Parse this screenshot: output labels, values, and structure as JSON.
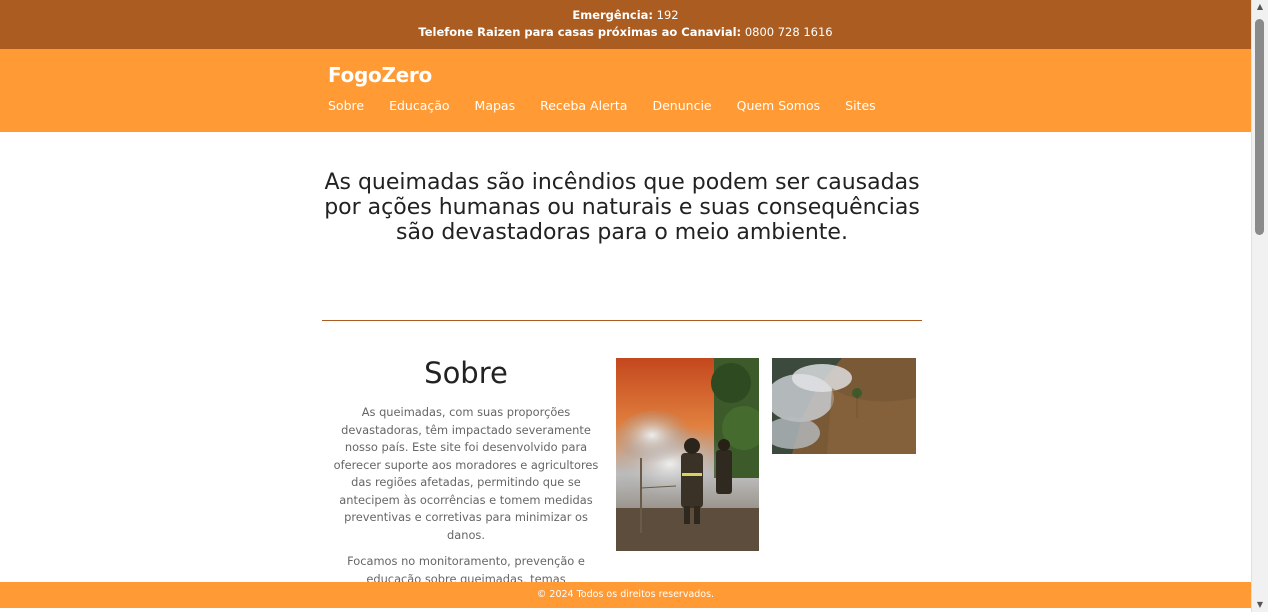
{
  "topbar": {
    "emergency_label": "Emergência:",
    "emergency_number": "192",
    "phone_label": "Telefone Raizen para casas próximas ao Canavial:",
    "phone_number": "0800 728 1616"
  },
  "header": {
    "brand": "FogoZero",
    "nav": [
      "Sobre",
      "Educação",
      "Mapas",
      "Receba Alerta",
      "Denuncie",
      "Quem Somos",
      "Sites"
    ]
  },
  "hero": {
    "text": "As queimadas são incêndios que podem ser causadas por ações humanas ou naturais e suas consequências são devastadoras para o meio ambiente."
  },
  "about": {
    "title": "Sobre",
    "paragraph1": "As queimadas, com suas proporções devastadoras, têm impactado severamente nosso país. Este site foi desenvolvido para oferecer suporte aos moradores e agricultores das regiões afetadas, permitindo que se antecipem às ocorrências e tomem medidas preventivas e corretivas para minimizar os danos.",
    "paragraph2": "Focamos no monitoramento, prevenção e educação sobre queimadas, temas"
  },
  "footer": {
    "text": "© 2024 Todos os direitos reservados."
  },
  "colors": {
    "topbar": "#ab5d21",
    "navbar": "#ff9a35",
    "divider": "#ab5d21"
  }
}
